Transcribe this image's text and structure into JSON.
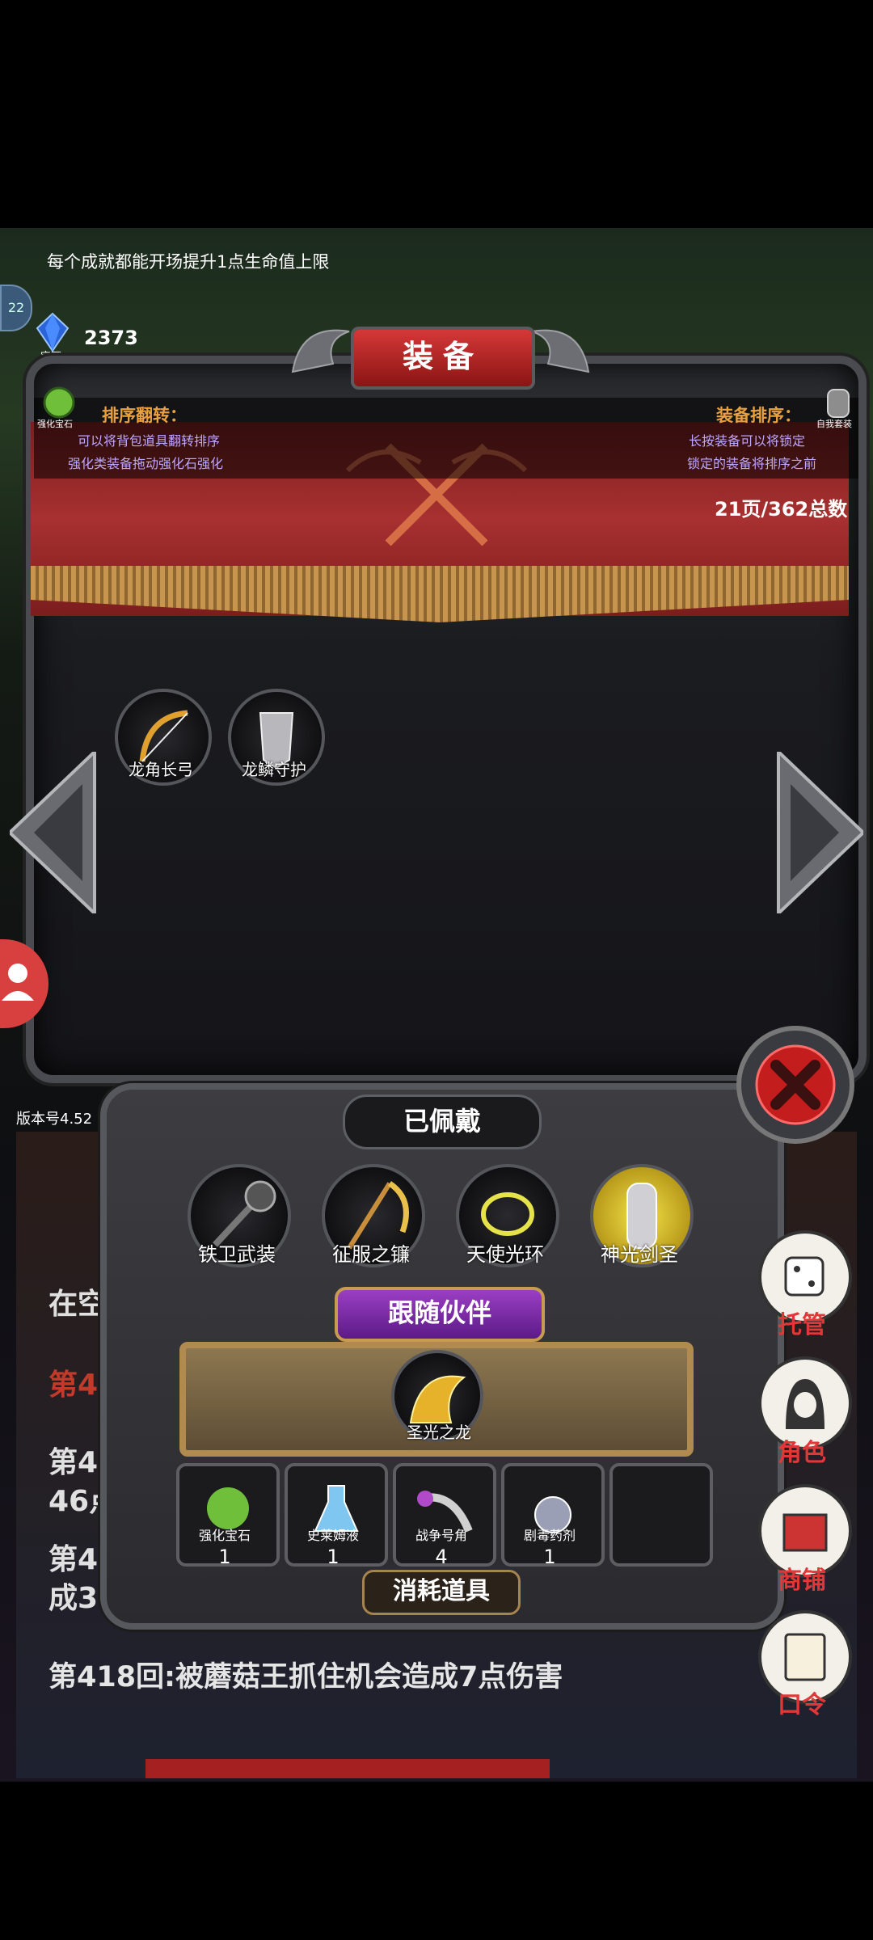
{
  "hint": "每个成就都能开场提升1点生命值上限",
  "level_bubble": "22",
  "gem": {
    "count": "2373",
    "label": "宝石"
  },
  "panel": {
    "title": "装备",
    "reverse": {
      "title": "排序翻转：",
      "line1": "可以将背包道具翻转排序",
      "line2": "强化类装备拖动强化石强化"
    },
    "sort": {
      "title": "装备排序：",
      "line1": "长按装备可以将锁定",
      "line2": "锁定的装备将排序之前"
    },
    "stone_label": "强化宝石",
    "self_label": "自我套装",
    "page_info": "21页/362总数",
    "items": [
      {
        "name": "龙角长弓",
        "icon": "bow-icon"
      },
      {
        "name": "龙鳞守护",
        "icon": "armor-icon"
      }
    ]
  },
  "version": "版本号4.52",
  "log": {
    "a": "在空",
    "b": "第42回",
    "c": "第41",
    "d": "46点",
    "e": "第41",
    "f": "成3",
    "main": "第418回:被蘑菇王抓住机会造成7点伤害"
  },
  "equipped": {
    "title": "已佩戴",
    "items": [
      {
        "name": "铁卫武装",
        "icon": "mace-icon"
      },
      {
        "name": "征服之镰",
        "icon": "scythe-icon"
      },
      {
        "name": "天使光环",
        "icon": "halo-icon"
      },
      {
        "name": "神光剑圣",
        "icon": "knight-icon"
      }
    ]
  },
  "companion": {
    "title": "跟随伙伴",
    "name": "圣光之龙"
  },
  "consumables": {
    "title": "消耗道具",
    "items": [
      {
        "name": "强化宝石",
        "count": "1"
      },
      {
        "name": "史莱姆液",
        "count": "1"
      },
      {
        "name": "战争号角",
        "count": "4"
      },
      {
        "name": "剧毒药剂",
        "count": "1"
      }
    ]
  },
  "side": {
    "auto": "托管",
    "role": "角色",
    "shop": "商铺",
    "code": "口令"
  },
  "colors": {
    "accent_red": "#a83030",
    "gold": "#e8a040",
    "purple_text": "#bca8ff"
  }
}
